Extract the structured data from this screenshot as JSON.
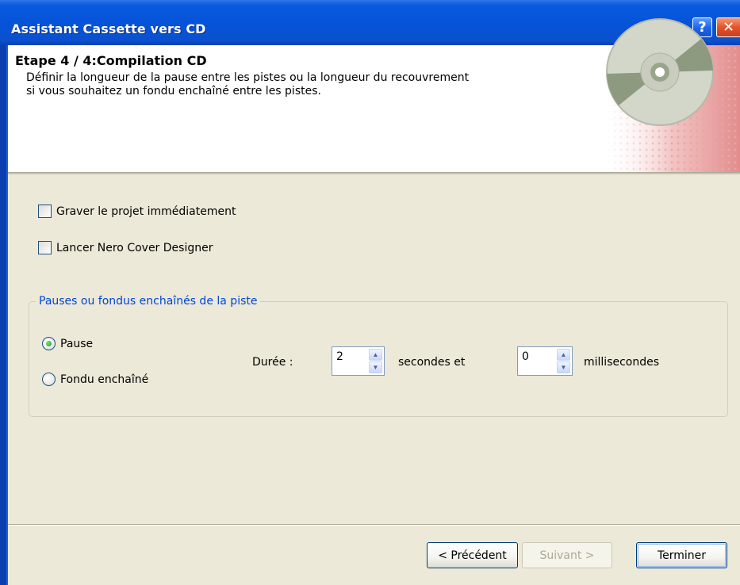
{
  "window": {
    "title": "Assistant Cassette vers CD",
    "help_button": "?",
    "close_button": "✕"
  },
  "header": {
    "step_title": "Etape 4 / 4:Compilation CD",
    "description": "Définir la longueur de la pause entre les pistes ou la longueur du recouvrement\nsi vous souhaitez un fondu enchaîné entre les pistes.",
    "graphic_icon": "cd-disc-icon"
  },
  "options": {
    "burn_now": {
      "label": "Graver le projet immédiatement",
      "checked": false
    },
    "cover_designer": {
      "label": "Lancer Nero Cover Designer",
      "checked": false
    }
  },
  "group": {
    "legend": "Pauses ou fondus enchaînés de la piste",
    "radios": [
      {
        "label": "Pause",
        "selected": true
      },
      {
        "label": "Fondu enchaîné",
        "selected": false
      }
    ],
    "duration_label": "Durée :",
    "seconds_value": "2",
    "seconds_unit": "secondes et",
    "milliseconds_value": "0",
    "milliseconds_unit": "millisecondes",
    "spin_up": "▲",
    "spin_down": "▼"
  },
  "footer": {
    "prev_label": "< Précédent",
    "next_label": "Suivant >",
    "finish_label": "Terminer"
  }
}
